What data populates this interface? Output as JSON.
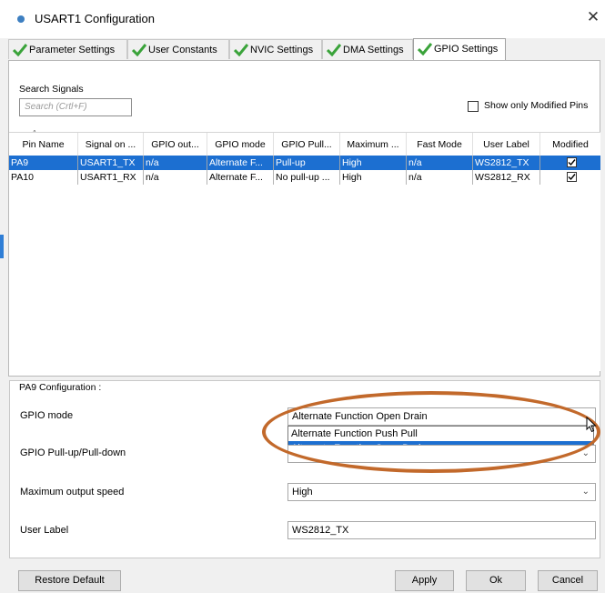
{
  "window": {
    "title": "USART1 Configuration",
    "close_label": "✕"
  },
  "tabs": [
    {
      "label": "Parameter Settings",
      "active": false
    },
    {
      "label": "User Constants",
      "active": false
    },
    {
      "label": "NVIC Settings",
      "active": false
    },
    {
      "label": "DMA Settings",
      "active": false
    },
    {
      "label": "GPIO Settings",
      "active": true
    }
  ],
  "search": {
    "label": "Search Signals",
    "placeholder": "Search (Crtl+F)"
  },
  "show_only_modified": {
    "label": "Show only Modified Pins",
    "checked": false
  },
  "table": {
    "columns": [
      "Pin Name",
      "Signal on ...",
      "GPIO out...",
      "GPIO mode",
      "GPIO Pull...",
      "Maximum ...",
      "Fast Mode",
      "User Label",
      "Modified"
    ],
    "rows": [
      {
        "cells": [
          "PA9",
          "USART1_TX",
          "n/a",
          "Alternate F...",
          "Pull-up",
          "High",
          "n/a",
          "WS2812_TX"
        ],
        "modified": true,
        "selected": true
      },
      {
        "cells": [
          "PA10",
          "USART1_RX",
          "n/a",
          "Alternate F...",
          "No pull-up ...",
          "High",
          "n/a",
          "WS2812_RX"
        ],
        "modified": true,
        "selected": false
      }
    ]
  },
  "config": {
    "title": "PA9 Configuration :",
    "gpio_mode_label": "GPIO mode",
    "gpio_mode_value": "Alternate Function Open Drain",
    "gpio_mode_options": [
      "Alternate Function Push Pull",
      "Alternate Function Open Drain"
    ],
    "gpio_mode_highlighted": "Alternate Function Open Drain",
    "pull_label": "GPIO Pull-up/Pull-down",
    "speed_label": "Maximum output speed",
    "speed_value": "High",
    "user_label_label": "User Label",
    "user_label_value": "WS2812_TX"
  },
  "buttons": {
    "restore": "Restore Default",
    "apply": "Apply",
    "ok": "Ok",
    "cancel": "Cancel"
  },
  "colors": {
    "selection": "#1c6fd1",
    "annotation": "#c2692b",
    "check_green": "#3aa33a"
  },
  "icons": {
    "tab_icon": "green-check-icon",
    "dropdown": "chevron-down-icon"
  }
}
